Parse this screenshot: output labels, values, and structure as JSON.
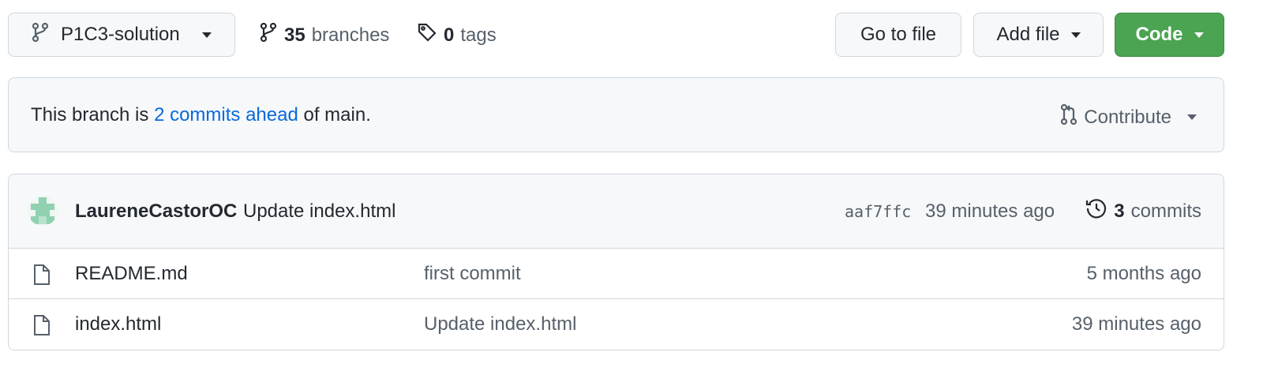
{
  "toolbar": {
    "branch_name": "P1C3-solution",
    "branches_count": "35",
    "branches_label": "branches",
    "tags_count": "0",
    "tags_label": "tags",
    "go_to_file": "Go to file",
    "add_file": "Add file",
    "code": "Code"
  },
  "banner": {
    "prefix": "This branch is ",
    "link": "2 commits ahead",
    "suffix": " of main.",
    "contribute": "Contribute"
  },
  "latest_commit": {
    "author": "LaureneCastorOC",
    "message": "Update index.html",
    "sha": "aaf7ffc",
    "time": "39 minutes ago",
    "commits_count": "3",
    "commits_label": "commits"
  },
  "files": [
    {
      "name": "README.md",
      "message": "first commit",
      "time": "5 months ago"
    },
    {
      "name": "index.html",
      "message": "Update index.html",
      "time": "39 minutes ago"
    }
  ],
  "colors": {
    "accent_link": "#0969da",
    "code_button": "#4aa452",
    "border": "#d0d7de",
    "avatar": "#8fd1b0"
  }
}
